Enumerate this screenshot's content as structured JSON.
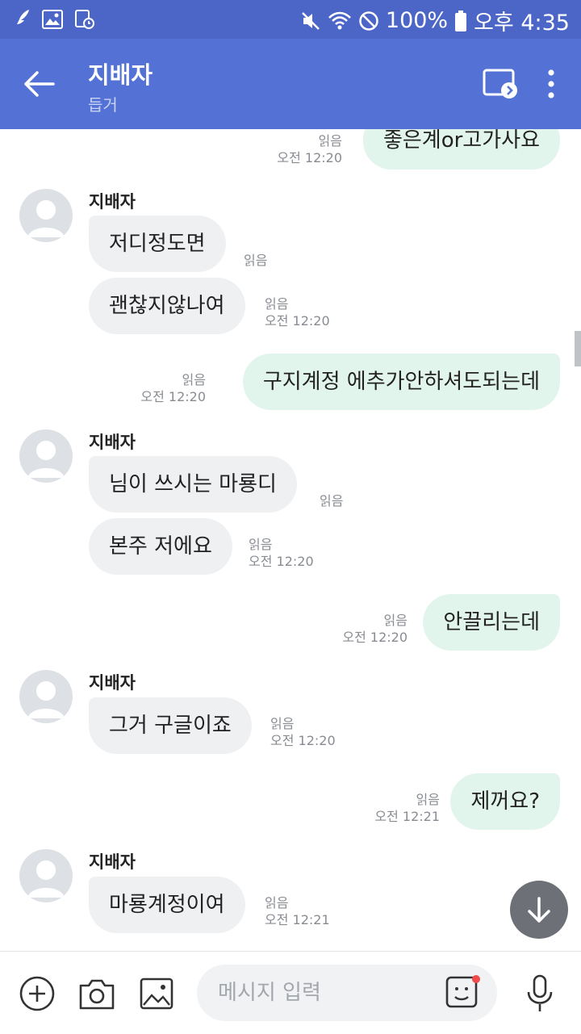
{
  "status_bar": {
    "battery": "100%",
    "time": "오후 4:35"
  },
  "header": {
    "title": "지배자",
    "subtitle": "듭거"
  },
  "messages": [
    {
      "dir": "out",
      "text": "좋은계or고가사요",
      "read": "읽음",
      "time": "오전 12:20"
    },
    {
      "dir": "in",
      "sender": "지배자",
      "text": "저디정도면",
      "read": "읽음",
      "time": ""
    },
    {
      "dir": "in",
      "text": "괜찮지않나여",
      "read": "읽음",
      "time": "오전 12:20"
    },
    {
      "dir": "out",
      "text": "구지계정 에추가안하셔도되는데",
      "read": "읽음",
      "time": "오전 12:20"
    },
    {
      "dir": "in",
      "sender": "지배자",
      "text": "님이 쓰시는 마룡디",
      "read": "읽음",
      "time": ""
    },
    {
      "dir": "in",
      "text": "본주 저에요",
      "read": "읽음",
      "time": "오전 12:20"
    },
    {
      "dir": "out",
      "text": "안끌리는데",
      "read": "읽음",
      "time": "오전 12:20"
    },
    {
      "dir": "in",
      "sender": "지배자",
      "text": "그거 구글이죠",
      "read": "읽음",
      "time": "오전 12:20"
    },
    {
      "dir": "out",
      "text": "제꺼요?",
      "read": "읽음",
      "time": "오전 12:21"
    },
    {
      "dir": "in",
      "sender": "지배자",
      "text": "마룡계정이여",
      "read": "읽음",
      "time": "오전 12:21"
    }
  ],
  "input": {
    "placeholder": "메시지 입력"
  },
  "colors": {
    "status_bar": "#4b66c6",
    "app_bar": "#5472d6",
    "incoming_bubble": "#eff0f2",
    "outgoing_bubble": "#e2f5ec",
    "notification_dot": "#f04a4a"
  },
  "icons": [
    "feather-icon",
    "image-icon",
    "alarm-icon",
    "mute-icon",
    "wifi-icon",
    "dnd-icon",
    "battery-icon",
    "back-arrow-icon",
    "cast-icon",
    "more-vert-icon",
    "person-icon",
    "arrow-down-icon",
    "plus-icon",
    "camera-icon",
    "gallery-icon",
    "sticker-icon",
    "mic-icon"
  ]
}
